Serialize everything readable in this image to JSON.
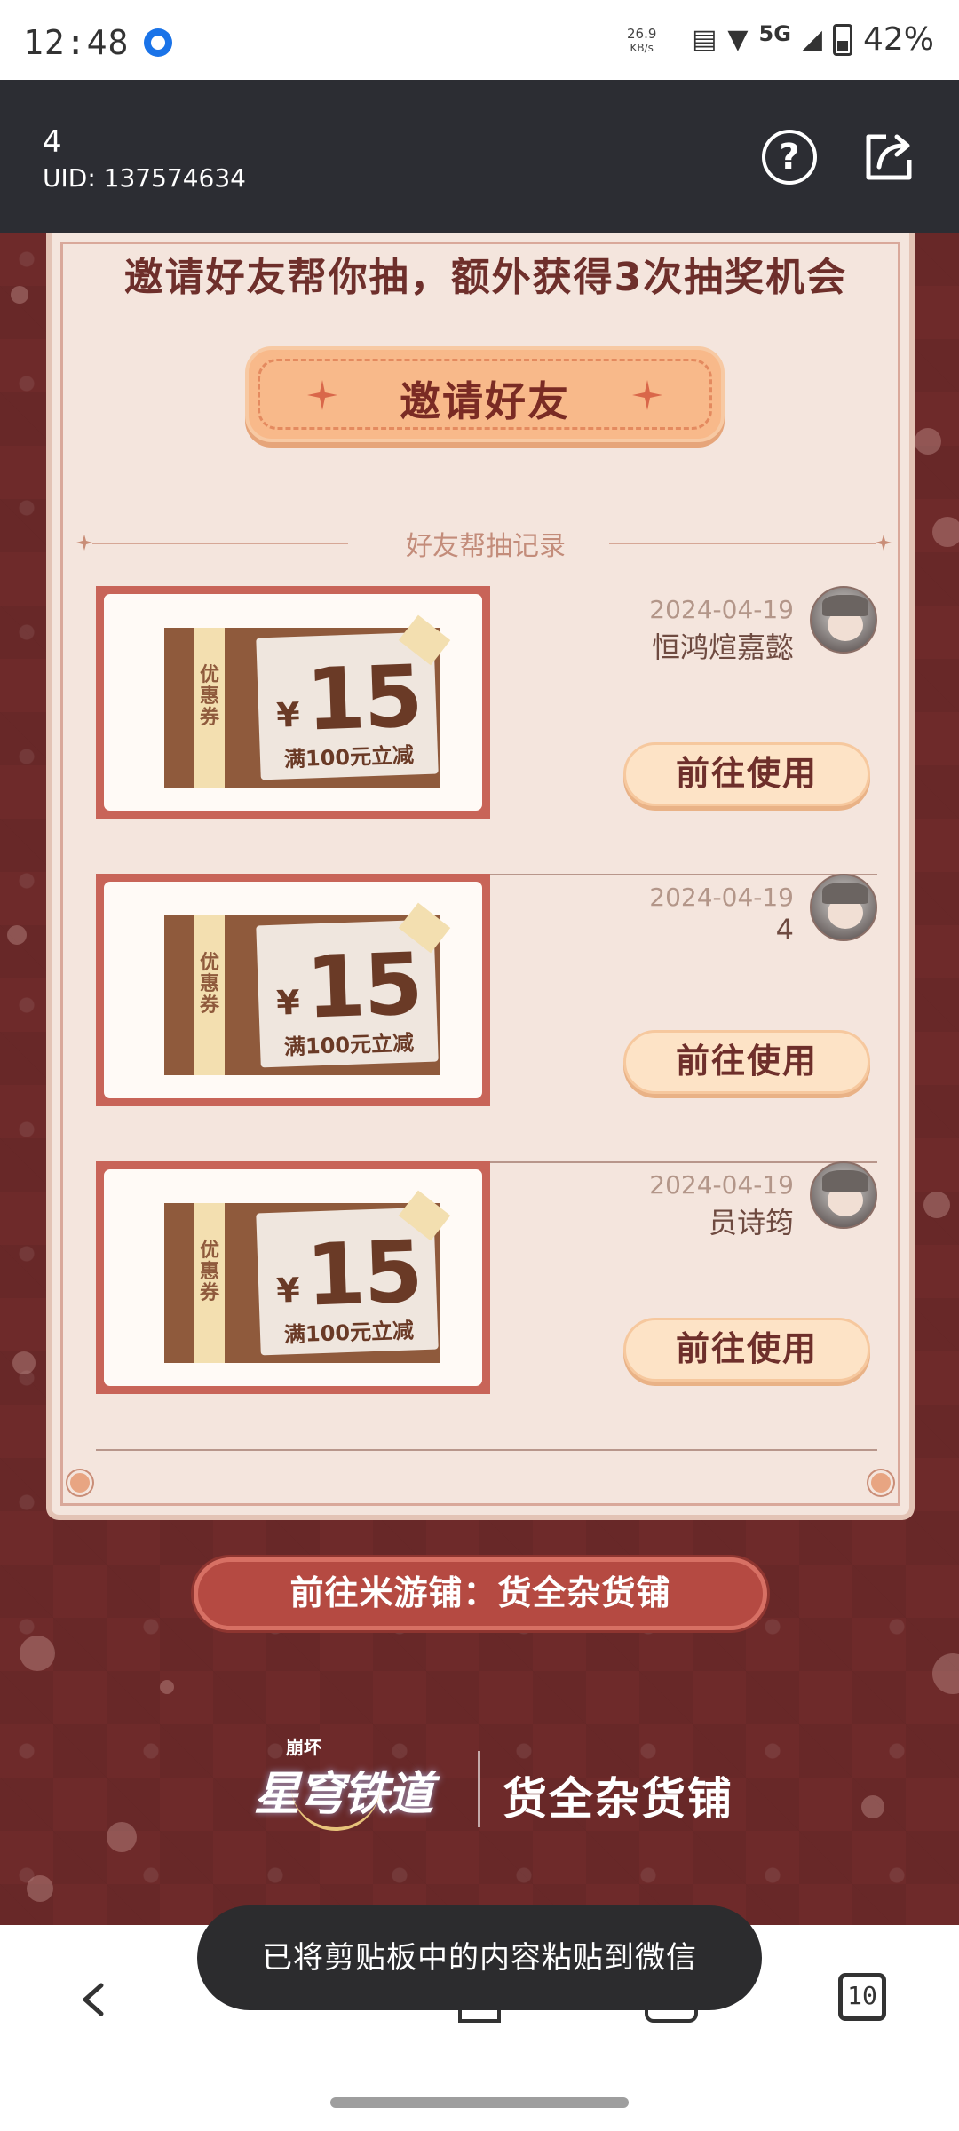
{
  "status_bar": {
    "time": "12:48",
    "net_speed_value": "26.9",
    "net_speed_unit": "KB/s",
    "network": "5G",
    "battery": "42%"
  },
  "header": {
    "user_name": "4",
    "uid": "UID: 137574634"
  },
  "card": {
    "title": "邀请好友帮你抽，额外获得3次抽奖机会",
    "invite_button": "邀请好友",
    "records_title": "好友帮抽记录"
  },
  "coupon": {
    "stub_label": "优惠券",
    "currency": "¥",
    "amount": "15",
    "condition": "满100元立减"
  },
  "records": [
    {
      "date": "2024-04-19",
      "name": "恒鸿煊嘉懿",
      "button": "前往使用"
    },
    {
      "date": "2024-04-19",
      "name": "4",
      "button": "前往使用"
    },
    {
      "date": "2024-04-19",
      "name": "员诗筠",
      "button": "前往使用"
    }
  ],
  "shop_link": "前往米游铺：货全杂货铺",
  "brand": {
    "game_small": "崩坏",
    "game_title": "星穹铁道",
    "shop_name": "货全杂货铺"
  },
  "toast": "已将剪贴板中的内容粘贴到微信",
  "nav": {
    "tabs_count": "10"
  },
  "colors": {
    "page_bg": "#6e2a2a",
    "card_bg": "#f4e5dd",
    "invite_button": "#f8b98a",
    "use_button": "#fde3c6",
    "shop_button": "#b54a42",
    "appbar": "#2c2d33"
  },
  "icons": [
    "help-icon",
    "share-icon",
    "back-icon",
    "tabs-icon",
    "avatar"
  ]
}
